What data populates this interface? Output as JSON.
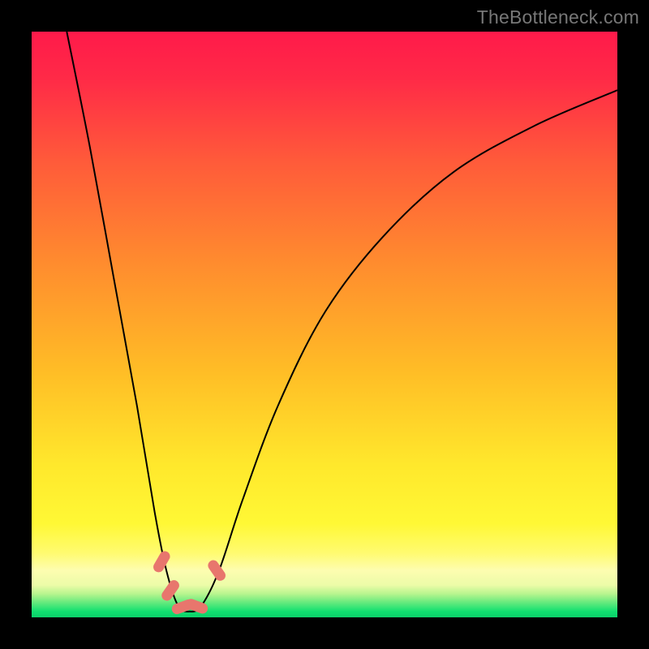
{
  "watermark": "TheBottleneck.com",
  "palette": {
    "red_top": "#ff1a4a",
    "orange_mid": "#ff8d2e",
    "yellow_low": "#fff835",
    "pale_band": "#fdfdb0",
    "green_line": "#10e070",
    "curve_color": "#000000",
    "marker_color": "#e8766d",
    "frame_bg": "#000000"
  },
  "chart_data": {
    "type": "line",
    "title": "",
    "xlabel": "",
    "ylabel": "",
    "xlim": [
      0,
      100
    ],
    "ylim": [
      0,
      100
    ],
    "note": "Axes are unlabeled; values are estimated from pixel position on a 0-100 normalized scale. The curve forms a deep V shape with trough near x≈26.",
    "series": [
      {
        "name": "curve",
        "x": [
          6,
          10,
          14,
          18,
          21,
          23,
          25,
          27,
          29,
          32,
          36,
          42,
          50,
          60,
          72,
          86,
          100
        ],
        "y": [
          100,
          80,
          58,
          36,
          18,
          8,
          2,
          1,
          2,
          8,
          20,
          36,
          52,
          65,
          76,
          84,
          90
        ]
      }
    ],
    "markers": [
      {
        "x": 22.2,
        "y": 9.5,
        "shape": "pill",
        "angle": -60
      },
      {
        "x": 23.7,
        "y": 4.6,
        "shape": "pill",
        "angle": -55
      },
      {
        "x": 25.8,
        "y": 1.8,
        "shape": "pill",
        "angle": -20
      },
      {
        "x": 28.2,
        "y": 1.9,
        "shape": "pill",
        "angle": 20
      },
      {
        "x": 31.6,
        "y": 8.0,
        "shape": "pill",
        "angle": 55
      }
    ],
    "marker_size": {
      "length": 28,
      "width": 13
    }
  }
}
